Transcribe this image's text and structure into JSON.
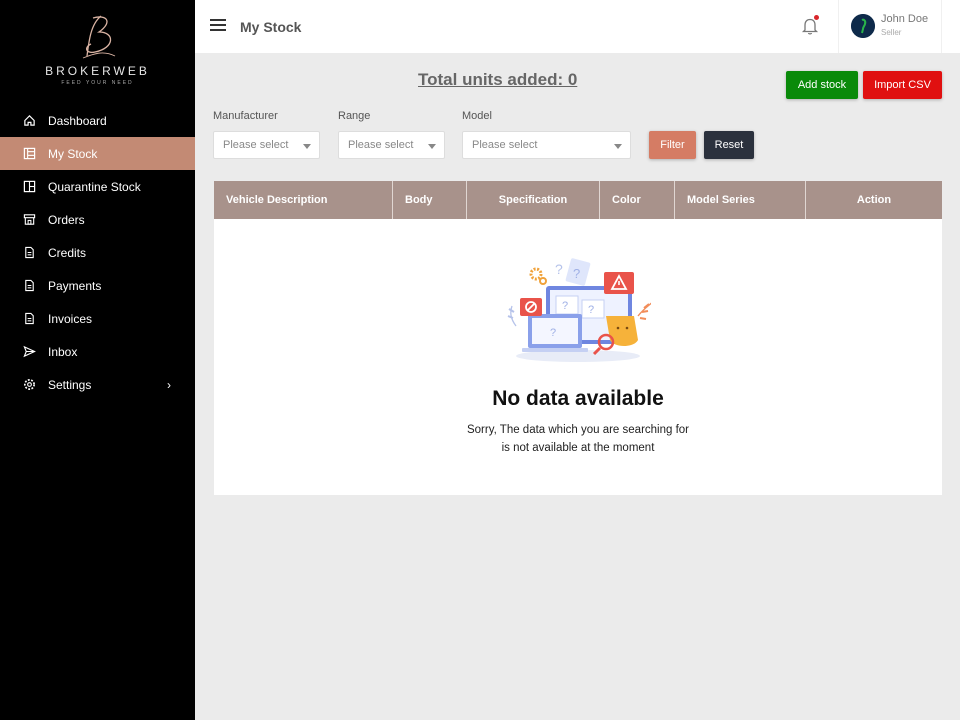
{
  "brand": {
    "name": "BROKERWEB",
    "tagline": "FEED YOUR NEED"
  },
  "sidebar": {
    "items": [
      {
        "label": "Dashboard",
        "icon": "home-icon",
        "active": false
      },
      {
        "label": "My Stock",
        "icon": "list-icon",
        "active": true
      },
      {
        "label": "Quarantine Stock",
        "icon": "layout-icon",
        "active": false
      },
      {
        "label": "Orders",
        "icon": "store-icon",
        "active": false
      },
      {
        "label": "Credits",
        "icon": "document-icon",
        "active": false
      },
      {
        "label": "Payments",
        "icon": "document-icon",
        "active": false
      },
      {
        "label": "Invoices",
        "icon": "document-icon",
        "active": false
      },
      {
        "label": "Inbox",
        "icon": "send-icon",
        "active": false
      },
      {
        "label": "Settings",
        "icon": "gear-icon",
        "active": false,
        "has_submenu": true
      }
    ]
  },
  "header": {
    "title": "My Stock",
    "user": {
      "name": "John Doe",
      "role": "Seller"
    },
    "notification_dot": true
  },
  "main": {
    "total_units": "Total units added: 0",
    "add_stock_label": "Add stock",
    "import_csv_label": "Import CSV",
    "filters": {
      "manufacturer": {
        "label": "Manufacturer",
        "placeholder": "Please select"
      },
      "range": {
        "label": "Range",
        "placeholder": "Please select"
      },
      "model": {
        "label": "Model",
        "placeholder": "Please select"
      },
      "filter_label": "Filter",
      "reset_label": "Reset"
    },
    "table": {
      "columns": [
        "Vehicle Description",
        "Body",
        "Specification",
        "Color",
        "Model Series",
        "Action"
      ],
      "empty_title": "No data available",
      "empty_line1": "Sorry, The data which you are searching for",
      "empty_line2": "is not available at the moment"
    }
  },
  "colors": {
    "sidebar_bg": "#000000",
    "active_item": "#c38a74",
    "table_header": "#a8928b",
    "add_stock": "#0a8a0a",
    "import_csv": "#e01010",
    "filter": "#d57c64",
    "reset": "#2b313d"
  }
}
